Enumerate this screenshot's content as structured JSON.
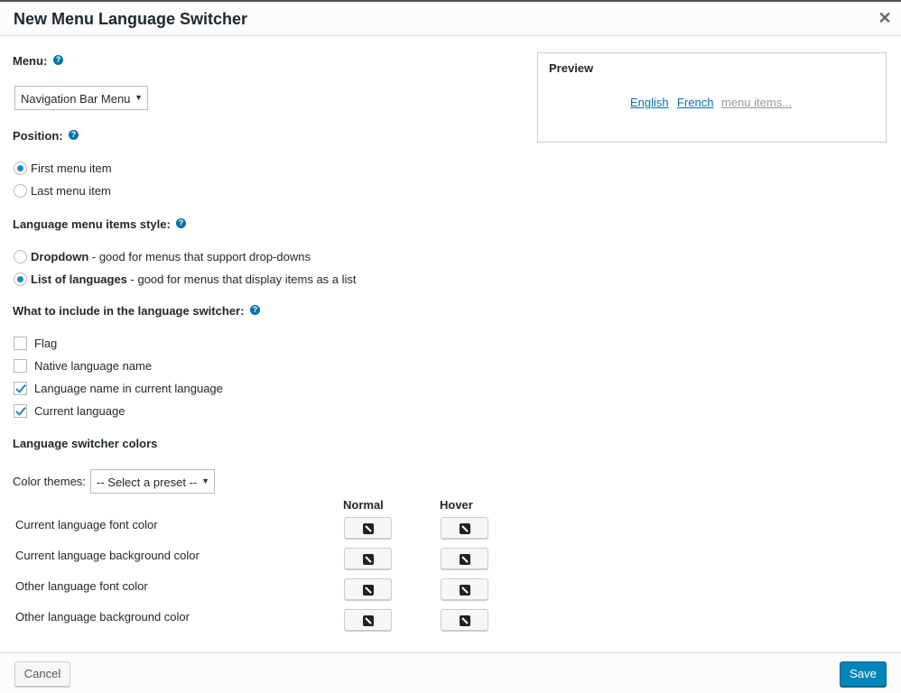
{
  "dialog": {
    "title": "New Menu Language Switcher",
    "close_symbol": "✕"
  },
  "menu": {
    "label": "Menu:",
    "selected": "Navigation Bar Menu"
  },
  "position": {
    "label": "Position:",
    "options": [
      "First menu item",
      "Last menu item"
    ],
    "selected": "First menu item"
  },
  "style": {
    "label": "Language menu items style:",
    "options": [
      {
        "name": "Dropdown",
        "desc": " - good for menus that support drop-downs"
      },
      {
        "name": "List of languages",
        "desc": " - good for menus that display items as a list"
      }
    ],
    "selected": "List of languages"
  },
  "include": {
    "label": "What to include in the language switcher:",
    "items": [
      {
        "label": "Flag",
        "checked": false
      },
      {
        "label": "Native language name",
        "checked": false
      },
      {
        "label": "Language name in current language",
        "checked": true
      },
      {
        "label": "Current language",
        "checked": true
      }
    ]
  },
  "colors": {
    "heading": "Language switcher colors",
    "themes_label": "Color themes:",
    "preset": "-- Select a preset --",
    "col_normal": "Normal",
    "col_hover": "Hover",
    "rows": [
      "Current language font color",
      "Current language background color",
      "Other language font color",
      "Other language background color"
    ]
  },
  "preview": {
    "title": "Preview",
    "links": [
      "English",
      "French"
    ],
    "more": "menu items..."
  },
  "footer": {
    "cancel": "Cancel",
    "save": "Save"
  },
  "help_glyph": "?",
  "select_arrow": "▼",
  "theme": {
    "accent": "#0085ba",
    "link": "#0073aa",
    "radio": "#1e8cbe"
  }
}
